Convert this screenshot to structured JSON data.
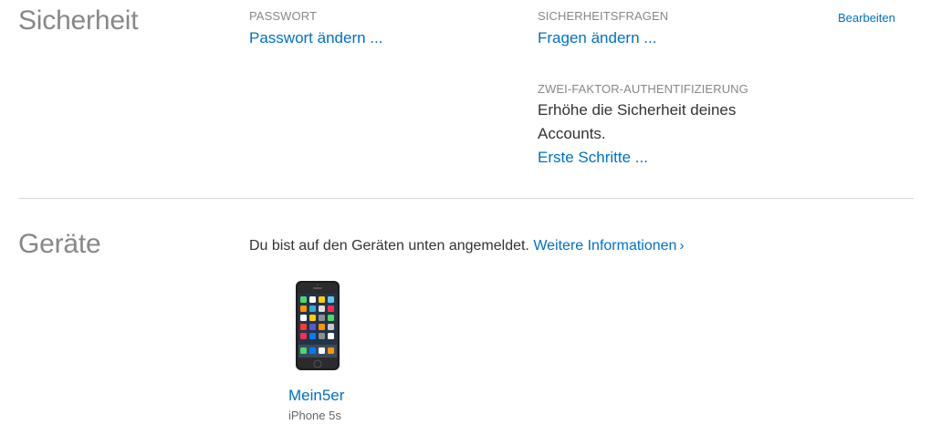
{
  "security": {
    "title": "Sicherheit",
    "edit_label": "Bearbeiten",
    "password": {
      "label": "PASSWORT",
      "link": "Passwort ändern ..."
    },
    "questions": {
      "label": "SICHERHEITSFRAGEN",
      "link": "Fragen ändern ..."
    },
    "two_factor": {
      "label": "ZWEI-FAKTOR-AUTHENTIFIZIERUNG",
      "text_line1": "Erhöhe die Sicherheit deines",
      "text_line2": "Accounts.",
      "link": "Erste Schritte ..."
    }
  },
  "devices": {
    "title": "Geräte",
    "intro": "Du bist auf den Geräten unten angemeldet.",
    "more_info": "Weitere Informationen",
    "more_info_chevron": "›",
    "items": [
      {
        "name": "Mein5er",
        "model": "iPhone 5s",
        "icon": "iphone-icon"
      }
    ]
  },
  "colors": {
    "link": "#0070c9",
    "title": "#888888",
    "text": "#333333",
    "divider": "#d6d6d6"
  }
}
